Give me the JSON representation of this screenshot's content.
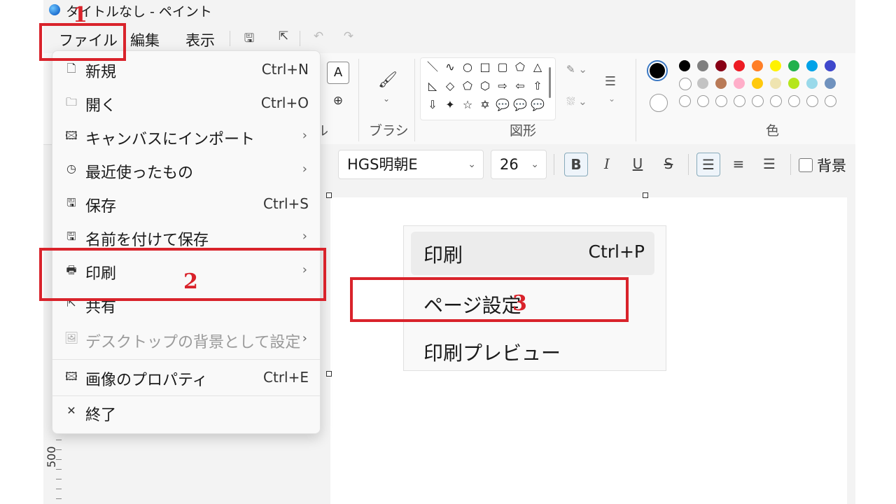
{
  "window": {
    "title": "タイトルなし - ペイント"
  },
  "menubar": {
    "file": "ファイル",
    "edit": "編集",
    "view": "表示"
  },
  "quick_access": {
    "save": "save-icon",
    "share": "share-icon",
    "undo": "undo-icon",
    "redo": "redo-icon"
  },
  "ribbon": {
    "tools_label_partial": "ル",
    "brushes_label": "ブラシ",
    "shapes_label": "図形",
    "colors_label": "色",
    "text_tool_glyph": "A",
    "zoom_glyph": "⊕",
    "shapes": [
      "＼",
      "∿",
      "○",
      "□",
      "▢",
      "⬠",
      "△",
      "◺",
      "◇",
      "⬠",
      "⬡",
      "⇨",
      "⇦",
      "⇧",
      "⇩",
      "✦",
      "☆",
      "✡",
      "💬",
      "💬",
      "💬"
    ],
    "colors": {
      "primary": "#000000",
      "row1": [
        "#000000",
        "#7f7f7f",
        "#880015",
        "#ed1c24",
        "#ff7f27",
        "#fff200",
        "#22b14c",
        "#00a2e8",
        "#3f48cc"
      ],
      "row2": [
        "#ffffff",
        "#c3c3c3",
        "#b97a57",
        "#ffaec9",
        "#ffc90e",
        "#efe4b0",
        "#b5e61d",
        "#99d9ea",
        "#7092be"
      ]
    }
  },
  "text_format": {
    "font_name": "HGS明朝E",
    "font_size": "26",
    "bold": "B",
    "italic": "I",
    "underline": "U",
    "strike": "S",
    "background_label": "背景"
  },
  "file_menu": {
    "items": [
      {
        "icon": "new-file-icon",
        "glyph": "🗋",
        "label": "新規",
        "shortcut": "Ctrl+N",
        "submenu": false,
        "enabled": true
      },
      {
        "icon": "open-folder-icon",
        "glyph": "🗀",
        "label": "開く",
        "shortcut": "Ctrl+O",
        "submenu": false,
        "enabled": true
      },
      {
        "icon": "import-icon",
        "glyph": "🖾",
        "label": "キャンバスにインポート",
        "shortcut": "",
        "submenu": true,
        "enabled": true
      },
      {
        "icon": "recent-clock-icon",
        "glyph": "◷",
        "label": "最近使ったもの",
        "shortcut": "",
        "submenu": true,
        "enabled": true
      },
      {
        "icon": "save-icon",
        "glyph": "🖫",
        "label": "保存",
        "shortcut": "Ctrl+S",
        "submenu": false,
        "enabled": true
      },
      {
        "icon": "save-as-icon",
        "glyph": "🖫",
        "label": "名前を付けて保存",
        "shortcut": "",
        "submenu": true,
        "enabled": true
      },
      {
        "icon": "print-icon",
        "glyph": "🖶",
        "label": "印刷",
        "shortcut": "",
        "submenu": true,
        "enabled": true
      },
      {
        "icon": "share-icon",
        "glyph": "⇱",
        "label": "共有",
        "shortcut": "",
        "submenu": false,
        "enabled": true
      },
      {
        "icon": "desktop-background-icon",
        "glyph": "🖼",
        "label": "デスクトップの背景として設定",
        "shortcut": "",
        "submenu": true,
        "enabled": false
      },
      {
        "icon": "image-properties-icon",
        "glyph": "🖾",
        "label": "画像のプロパティ",
        "shortcut": "Ctrl+E",
        "submenu": false,
        "enabled": true
      },
      {
        "icon": "exit-x-icon",
        "glyph": "✕",
        "label": "終了",
        "shortcut": "",
        "submenu": false,
        "enabled": true
      }
    ]
  },
  "print_submenu": {
    "print": "印刷",
    "print_shortcut": "Ctrl+P",
    "page_setup": "ページ設定",
    "print_preview": "印刷プレビュー"
  },
  "ruler": {
    "mark": "500"
  },
  "annotations": {
    "step1": "1",
    "step2": "2",
    "step3": "3",
    "color": "#d9232b"
  }
}
